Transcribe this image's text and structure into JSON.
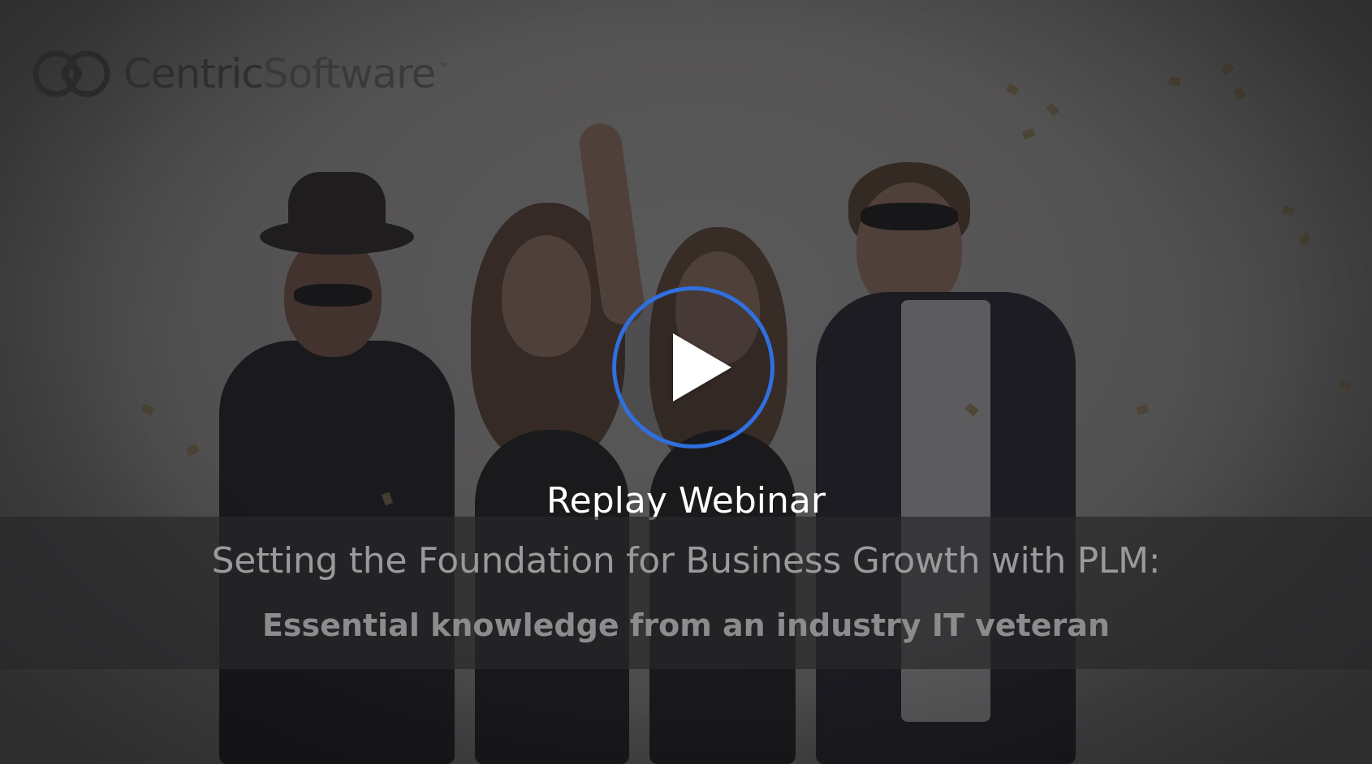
{
  "brand": {
    "name_bold": "Centric",
    "name_light": "Software",
    "trademark": "™"
  },
  "video": {
    "play_label": "Replay Webinar",
    "play_icon": "play-icon",
    "accent_color": "#2f6fde"
  },
  "webinar": {
    "title": "Setting the Foundation for Business Growth with PLM:",
    "subtitle": "Essential knowledge from an industry IT veteran"
  }
}
